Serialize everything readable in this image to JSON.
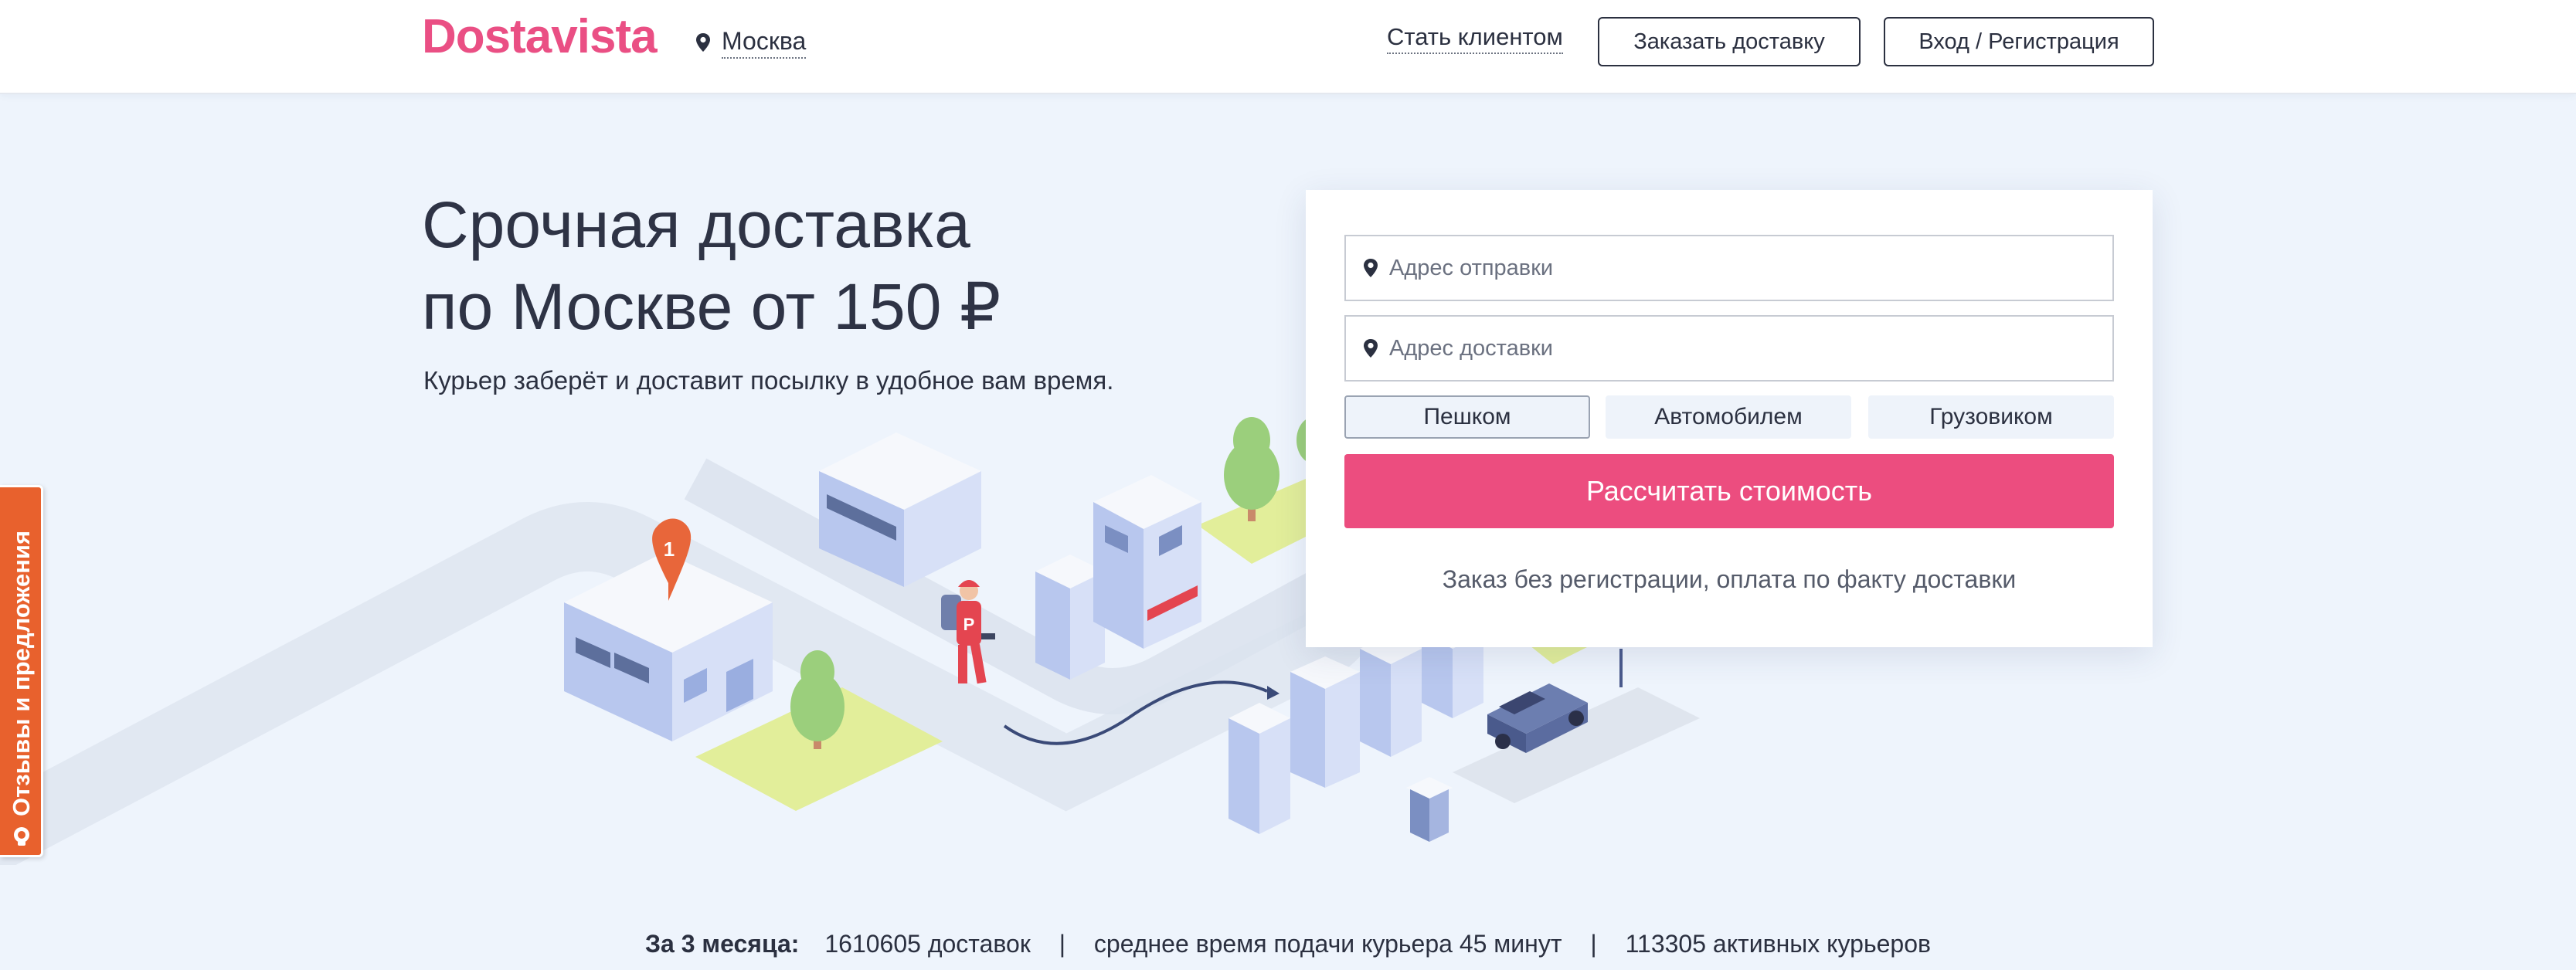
{
  "header": {
    "logo": "Dostavista",
    "city": "Москва",
    "become_client": "Стать клиентом",
    "order_button": "Заказать доставку",
    "login_button": "Вход / Регистрация"
  },
  "hero": {
    "title_line1": "Срочная доставка",
    "title_line2": "по Москве от 150 ₽",
    "subtitle": "Курьер заберёт и доставит посылку в удобное вам время."
  },
  "illustration": {
    "marker_number": "1",
    "bag_letter": "Р"
  },
  "form": {
    "from_placeholder": "Адрес отправки",
    "to_placeholder": "Адрес доставки",
    "modes": [
      "Пешком",
      "Автомобилем",
      "Грузовиком"
    ],
    "active_mode": "Пешком",
    "submit": "Рассчитать стоимость",
    "note": "Заказ без регистрации, оплата по факту доставки"
  },
  "feedback": {
    "label": "Отзывы и предложения"
  },
  "stats": {
    "lead": "За 3 месяца:",
    "deliveries": "1610605 доставок",
    "separator": "|",
    "avg_time": "среднее время подачи курьера 45 минут",
    "couriers": "113305 активных курьеров"
  },
  "colors": {
    "brand_pink": "#ea4f84",
    "button_pink": "#ec4d7f",
    "background": "#eef4fc",
    "feedback_orange": "#e8612d"
  }
}
